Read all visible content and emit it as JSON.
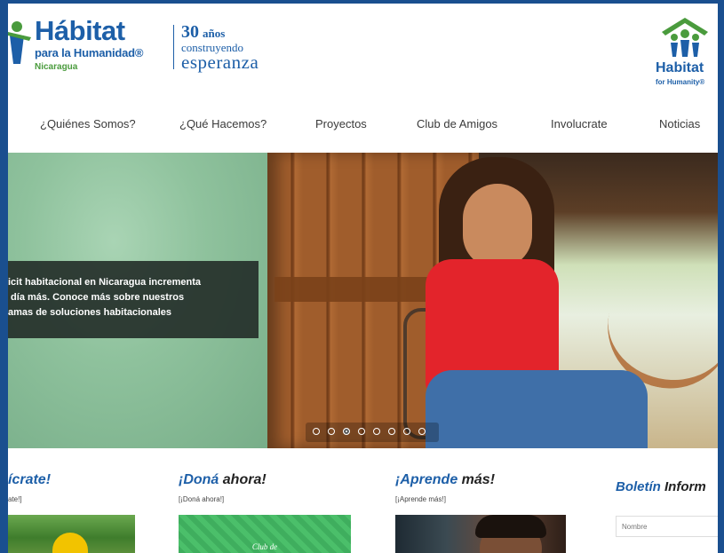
{
  "header": {
    "logo_title": "Hábitat",
    "logo_subtitle": "para la Humanidad®",
    "logo_country": "Nicaragua",
    "tagline_number": "30",
    "tagline_anos": "años",
    "tagline_line2": "construyendo",
    "tagline_line3": "esperanza",
    "right_logo_word1": "Habitat",
    "right_logo_word2": "for Humanity®"
  },
  "nav": {
    "items": [
      "¿Quiénes Somos?",
      "¿Qué Hacemos?",
      "Proyectos",
      "Club de Amigos",
      "Involucrate",
      "Noticias"
    ]
  },
  "hero": {
    "caption": "icit habitacional en Nicaragua incrementa\n día más. Conoce más sobre nuestros\namas de soluciones habitacionales",
    "slide_count": 8,
    "active_slide": 3
  },
  "sections": {
    "involucrate_title": "ícrate!",
    "involucrate_sub": "ate!]",
    "dona_title_a": "¡Doná",
    "dona_title_b": " ahora!",
    "dona_sub": "[¡Doná ahora!]",
    "aprende_title_a": "¡Aprende",
    "aprende_title_b": " más!",
    "aprende_sub": "[¡Aprende más!]",
    "boletin_title_a": "Boletín",
    "boletin_title_b": " Inform",
    "club_label": "Club de",
    "nombre_placeholder": "Nombre"
  },
  "colors": {
    "brand_blue": "#1d5fa8",
    "brand_green": "#4a9b3d",
    "frame_blue": "#1a4f8f"
  }
}
